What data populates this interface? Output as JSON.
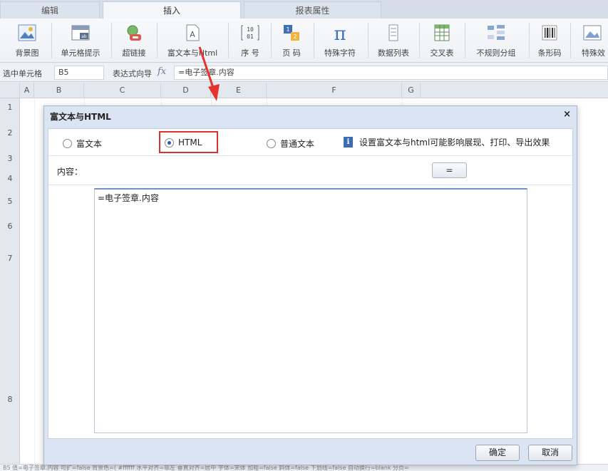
{
  "top_tabs": [
    {
      "label": "编辑"
    },
    {
      "label": "插入"
    },
    {
      "label": "报表属性"
    }
  ],
  "ribbon": {
    "items": [
      {
        "label": "背景图",
        "icon": "background-image-icon"
      },
      {
        "label": "单元格提示",
        "icon": "cell-tip-icon"
      },
      {
        "label": "超链接",
        "icon": "hyperlink-icon"
      },
      {
        "label": "富文本与Html",
        "icon": "richtext-html-icon"
      },
      {
        "label": "序 号",
        "icon": "sequence-icon",
        "glyph": "[10\n01]"
      },
      {
        "label": "页 码",
        "icon": "page-number-icon"
      },
      {
        "label": "特殊字符",
        "icon": "pi-icon",
        "glyph": "π"
      },
      {
        "label": "数据列表",
        "icon": "data-list-icon"
      },
      {
        "label": "交叉表",
        "icon": "cross-table-icon"
      },
      {
        "label": "不规则分组",
        "icon": "irregular-group-icon"
      },
      {
        "label": "条形码",
        "icon": "barcode-icon"
      },
      {
        "label": "特殊效",
        "icon": "special-effect-icon"
      }
    ]
  },
  "formula_bar": {
    "selected_cell_label": "选中单元格",
    "selected_cell_value": "B5",
    "expr_wizard_label": "表达式向导",
    "fx": "fx",
    "formula_value": "=电子签章.内容"
  },
  "grid": {
    "columns": [
      "A",
      "B",
      "C",
      "D",
      "E",
      "F",
      "G"
    ],
    "rows": [
      "1",
      "2",
      "3",
      "4",
      "5",
      "6",
      "7",
      "8"
    ]
  },
  "dialog": {
    "title": "富文本与HTML",
    "close": "×",
    "options": [
      {
        "label": "富文本",
        "selected": false
      },
      {
        "label": "HTML",
        "selected": true
      },
      {
        "label": "普通文本",
        "selected": false
      }
    ],
    "info_icon": "i",
    "info_text": "设置富文本与html可能影响展现、打印、导出效果",
    "content_label": "内容：",
    "eq_button": "=",
    "editor_value": "=电子签章.内容",
    "ok": "确定",
    "cancel": "取消"
  },
  "status_text": "B5 值=电子签章.内容 可扩=false 背景色=( #ffffff 水平对齐=靠左 垂直对齐=居中 字体=宋体 加粗=false 斜体=false 下划线=false 自动换行=blank 分页=",
  "colors": {
    "highlight": "#d9322e",
    "accent": "#2a5db0",
    "info_icon": "#3d6cb3"
  }
}
